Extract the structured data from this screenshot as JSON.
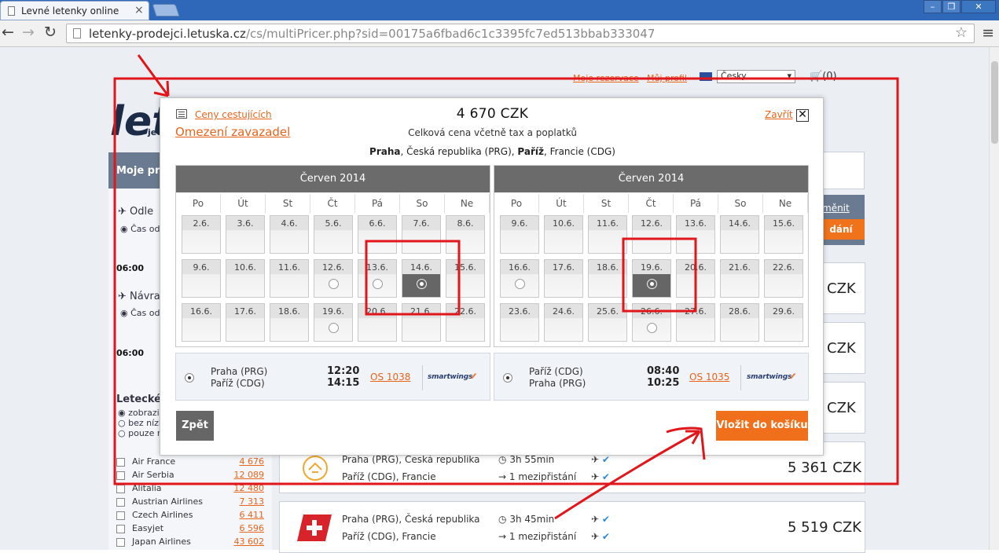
{
  "browser": {
    "tab_title": "Levné letenky online",
    "tab_close": "×",
    "url_host": "letenky-prodejci.letuska.cz",
    "url_path": "/cs/multiPricer.php?sid=00175a6fbad6c1c3395fc7ed513bbab333047",
    "icons": [
      "document-icon",
      "back-arrow-icon",
      "forward-arrow-icon",
      "reload-icon",
      "star-icon",
      "menu-icon"
    ]
  },
  "background": {
    "top_links": [
      "Moje rezervace",
      "Můj profil"
    ],
    "language": "Česky",
    "cart_label": "(0)",
    "logo_text": "let",
    "logo_sub": "jed",
    "left_bar_title": "Moje pre",
    "outbound_label": "Odle",
    "outbound_time_label": "Čas od",
    "outbound_time": "06:00",
    "return_label": "Návra",
    "return_time_label": "Čas od",
    "return_time": "06:00",
    "airlines_title": "Letecké s",
    "filter_options": [
      "zobrazit",
      "bez nízk",
      "pouze n"
    ],
    "airlines": [
      {
        "name": "Air France",
        "price": "4 676"
      },
      {
        "name": "Air Serbia",
        "price": "12 089"
      },
      {
        "name": "Alitalia",
        "price": "12 480"
      },
      {
        "name": "Austrian Airlines",
        "price": "7 313"
      },
      {
        "name": "Czech Airlines",
        "price": "6 411"
      },
      {
        "name": "Easyjet",
        "price": "6 596"
      },
      {
        "name": "Japan Airlines",
        "price": "43 602"
      }
    ],
    "zmenit": "měnit",
    "hledani": "dání",
    "results": [
      {
        "price": "CZK"
      },
      {
        "price": "CZK"
      },
      {
        "price": "CZK"
      },
      {
        "from": "Praha (PRG), Česká republika",
        "to": "Paříž (CDG), Francie",
        "duration": "3h 55min",
        "stops": "1 mezipřistání",
        "price": "5 361 CZK"
      },
      {
        "from": "Praha (PRG), Česká republika",
        "to": "Paříž (CDG), Francie",
        "duration": "3h 45min",
        "stops": "1 mezipřistání",
        "price": "5 519 CZK"
      }
    ]
  },
  "modal": {
    "passenger_prices_link": "Ceny cestujících",
    "baggage_link": "Omezení zavazadel",
    "price": "4 670  CZK",
    "price_note": "Celková cena včetně tax a poplatků",
    "route_from_city": "Praha",
    "route_from_rest": ", Česká republika (PRG), ",
    "route_to_city": "Paříž",
    "route_to_rest": ", Francie (CDG)",
    "close_label": "Zavřít",
    "close_icon": "✕",
    "back_button": "Zpět",
    "cart_button": "Vložit do košíku",
    "calendars": [
      {
        "month": "Červen 2014",
        "weekdays": [
          "Po",
          "Út",
          "St",
          "Čt",
          "Pá",
          "So",
          "Ne"
        ],
        "weeks": [
          [
            {
              "d": "2.6."
            },
            {
              "d": "3.6."
            },
            {
              "d": "4.6."
            },
            {
              "d": "5.6."
            },
            {
              "d": "6.6."
            },
            {
              "d": "7.6."
            },
            {
              "d": "8.6."
            }
          ],
          [
            {
              "d": "9.6."
            },
            {
              "d": "10.6."
            },
            {
              "d": "11.6."
            },
            {
              "d": "12.6.",
              "radio": "off"
            },
            {
              "d": "13.6.",
              "radio": "off"
            },
            {
              "d": "14.6.",
              "radio": "on"
            },
            {
              "d": "15.6."
            }
          ],
          [
            {
              "d": "16.6."
            },
            {
              "d": "17.6."
            },
            {
              "d": "18.6."
            },
            {
              "d": "19.6.",
              "radio": "off"
            },
            {
              "d": "20.6."
            },
            {
              "d": "21.6."
            },
            {
              "d": "22.6."
            }
          ]
        ]
      },
      {
        "month": "Červen 2014",
        "weekdays": [
          "Po",
          "Út",
          "St",
          "Čt",
          "Pá",
          "So",
          "Ne"
        ],
        "weeks": [
          [
            {
              "d": "9.6."
            },
            {
              "d": "10.6."
            },
            {
              "d": "11.6."
            },
            {
              "d": "12.6."
            },
            {
              "d": "13.6."
            },
            {
              "d": "14.6."
            },
            {
              "d": "15.6."
            }
          ],
          [
            {
              "d": "16.6.",
              "radio": "off"
            },
            {
              "d": "17.6."
            },
            {
              "d": "18.6."
            },
            {
              "d": "19.6.",
              "radio": "on"
            },
            {
              "d": "20.6."
            },
            {
              "d": "21.6."
            },
            {
              "d": "22.6."
            }
          ],
          [
            {
              "d": "23.6."
            },
            {
              "d": "24.6."
            },
            {
              "d": "25.6."
            },
            {
              "d": "26.6.",
              "radio": "off"
            },
            {
              "d": "27.6."
            },
            {
              "d": "28.6."
            },
            {
              "d": "29.6."
            }
          ]
        ]
      }
    ],
    "flights": [
      {
        "from": "Praha (PRG)",
        "to": "Paříž (CDG)",
        "dep": "12:20",
        "arr": "14:15",
        "code": "OS 1038",
        "carrier": "smartwings"
      },
      {
        "from": "Paříž (CDG)",
        "to": "Praha (PRG)",
        "dep": "08:40",
        "arr": "10:25",
        "code": "OS 1035",
        "carrier": "smartwings"
      }
    ]
  },
  "annotation_color": "#e0161b"
}
